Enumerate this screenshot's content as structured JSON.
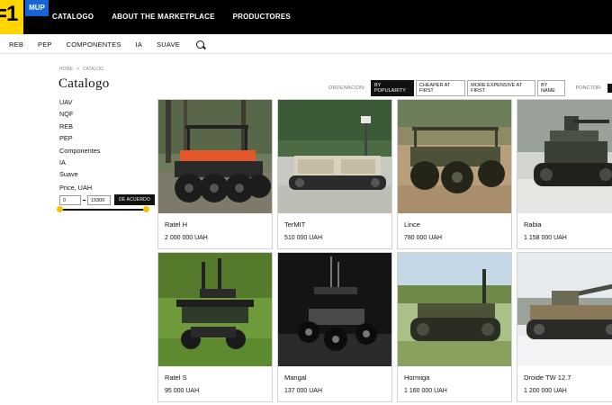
{
  "header": {
    "logo_text": "=1",
    "badge": "MUP",
    "nav": [
      "CATALOGO",
      "ABOUT THE MARKETPLACE",
      "PRODUCTORES"
    ]
  },
  "subnav": {
    "items": [
      "REB",
      "PEP",
      "COMPONENTES",
      "IA",
      "SUAVE"
    ],
    "search_icon": "search-icon"
  },
  "breadcrumb": [
    "HOME",
    ">",
    "CATALOG"
  ],
  "page_title": "Catalogo",
  "sorting": {
    "label": "ORDENACION:",
    "options": [
      "BY POPULARITY",
      "CHEAPER AT FIRST",
      "MORE EXPENSIVE AT FIRST",
      "BY NAME"
    ],
    "active": "BY POPULARITY",
    "second_label": "PONCTOR:"
  },
  "sidebar": {
    "categories": [
      "UAV",
      "NQF",
      "REB",
      "PEP",
      "Componentes",
      "IA",
      "Suave"
    ],
    "price_label": "Price, UAH",
    "price_min": "0",
    "price_max": "19300",
    "apply_label": "DE ACUERDO",
    "slider_range": [
      0,
      19300
    ],
    "accent_color": "#f2c200"
  },
  "products": [
    {
      "name": "Ratel H",
      "price": "2 000 000 UAH",
      "image": "orange-wheeled-robot"
    },
    {
      "name": "TerMIT",
      "price": "510 000 UAH",
      "image": "tracked-robot-with-mast"
    },
    {
      "name": "Lince",
      "price": "780 000 UAH",
      "image": "wheeled-cargo-robot"
    },
    {
      "name": "Rabia",
      "price": "1 158 000 UAH",
      "image": "armed-tracked-robot-snow"
    },
    {
      "name": "Ratel S",
      "price": "95 000 UAH",
      "image": "ratel-s-robot-grass"
    },
    {
      "name": "Mangal",
      "price": "137 000 UAH",
      "image": "small-wheeled-robot-dark"
    },
    {
      "name": "Hormiga",
      "price": "1 160 000 UAH",
      "image": "tracked-robot-field"
    },
    {
      "name": "Droide TW 12.7",
      "price": "1 200 000 UAH",
      "image": "turret-robot-snow"
    }
  ]
}
